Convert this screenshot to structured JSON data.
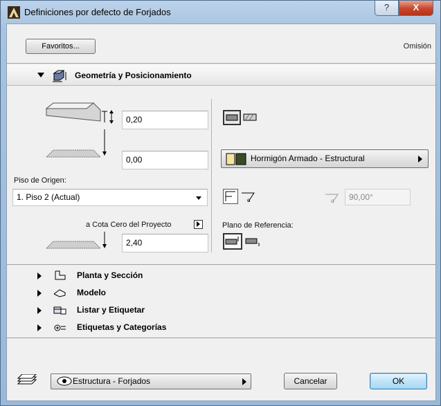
{
  "window": {
    "title": "Definiciones por defecto de Forjados",
    "help_label": "?",
    "close_label": "X"
  },
  "top": {
    "favoritos_label": "Favoritos...",
    "omision_label": "Omisión"
  },
  "geometry_panel": {
    "title": "Geometría y Posicionamiento",
    "thickness_value": "0,20",
    "offset_value": "0,00",
    "home_story_label": "Piso de Origen:",
    "home_story_value": "1. Piso 2 (Actual)",
    "project_zero_label": "a Cota Cero del Proyecto",
    "project_zero_value": "2,40",
    "material_value": "Hormigón Armado - Estructural",
    "angle_value": "90,00°",
    "reference_plane_label": "Plano de Referencia:"
  },
  "sections": [
    {
      "label": "Planta y Sección",
      "icon": "floor-plan-icon"
    },
    {
      "label": "Modelo",
      "icon": "model-icon"
    },
    {
      "label": "Listar y Etiquetar",
      "icon": "listing-icon"
    },
    {
      "label": "Etiquetas y Categorías",
      "icon": "tags-icon"
    }
  ],
  "bottom": {
    "layer_value": "Estructura - Forjados",
    "cancel_label": "Cancelar",
    "ok_label": "OK"
  },
  "colors": {
    "ok_border": "#3c7fb1",
    "titlebar": "#bcd3ea",
    "close": "#c7462c"
  }
}
